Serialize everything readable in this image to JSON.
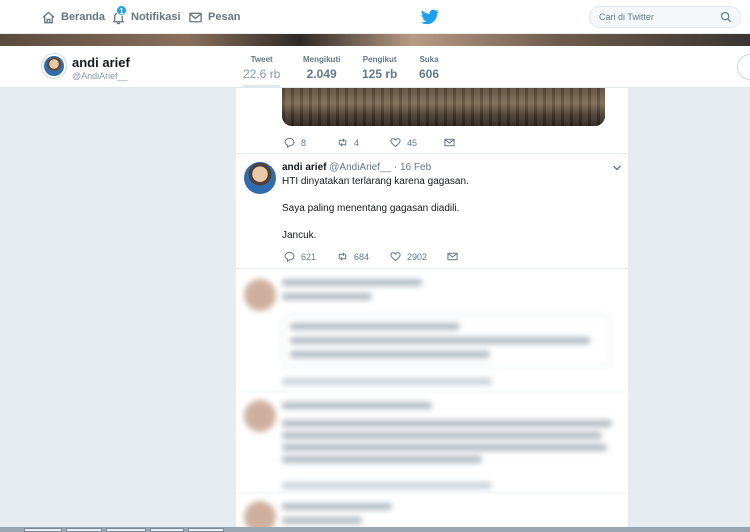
{
  "nav": {
    "home_label": "Beranda",
    "notifications_label": "Notifikasi",
    "notifications_badge": "1",
    "messages_label": "Pesan",
    "search_placeholder": "Cari di Twitter"
  },
  "profile": {
    "name": "andi arief",
    "handle": "@AndiArief__",
    "stats": [
      {
        "label": "Tweet",
        "value": "22,6 rb"
      },
      {
        "label": "Mengikuti",
        "value": "2.049"
      },
      {
        "label": "Pengikut",
        "value": "125 rb"
      },
      {
        "label": "Suka",
        "value": "606"
      }
    ]
  },
  "tweets": [
    {
      "replies": "8",
      "retweets": "4",
      "likes": "45"
    },
    {
      "name": "andi arief",
      "handle": "@AndiArief__",
      "date": "· 16 Feb",
      "lines": [
        "HTI dinyatakan terlarang karena gagasan.",
        "Saya paling menentang gagasan diadili.",
        "Jancuk."
      ],
      "replies": "621",
      "retweets": "684",
      "likes": "2902"
    }
  ],
  "colors": {
    "accent": "#1da1f2",
    "background": "#e6ecf0",
    "muted_text": "#657786"
  }
}
